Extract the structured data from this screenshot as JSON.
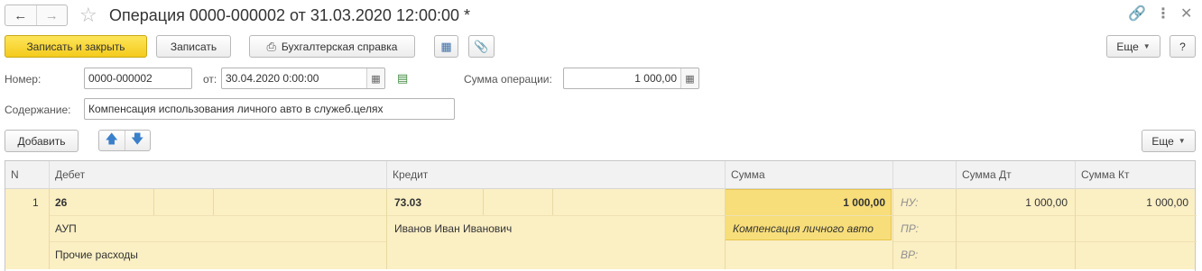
{
  "window": {
    "title": "Операция 0000-000002 от 31.03.2020 12:00:00 *"
  },
  "icons": {
    "back": "arrow-left-icon",
    "forward": "arrow-right-icon",
    "favorite": "star-icon",
    "link": "link-icon",
    "more": "more-vertical-icon",
    "close": "close-icon"
  },
  "toolbar": {
    "save_close": "Записать и закрыть",
    "save": "Записать",
    "report": "Бухгалтерская справка",
    "more": "Еще",
    "help": "?"
  },
  "form": {
    "number_label": "Номер:",
    "number_value": "0000-000002",
    "date_label": "от:",
    "date_value": "30.04.2020  0:00:00",
    "sum_label": "Сумма операции:",
    "sum_value": "1 000,00",
    "content_label": "Содержание:",
    "content_value": "Компенсация использования личного авто в служеб.целях"
  },
  "table_toolbar": {
    "add": "Добавить",
    "more": "Еще"
  },
  "table": {
    "headers": {
      "n": "N",
      "debit": "Дебет",
      "credit": "Кредит",
      "sum": "Сумма",
      "sum_dt": "Сумма Дт",
      "sum_kt": "Сумма Кт"
    },
    "row": {
      "n": "1",
      "debit_account": "26",
      "debit_sub1": "АУП",
      "debit_sub2": "Прочие расходы",
      "credit_account": "73.03",
      "credit_sub1": "Иванов Иван Иванович",
      "sum": "1 000,00",
      "comment": "Компенсация личного авто",
      "nu_label": "НУ:",
      "pr_label": "ПР:",
      "vr_label": "ВР:",
      "sum_dt": "1 000,00",
      "sum_kt": "1 000,00"
    }
  },
  "colors": {
    "primary_button": "#f4cb1c",
    "row_highlight": "#fbefc4",
    "comment_highlight": "#f7de7a"
  }
}
